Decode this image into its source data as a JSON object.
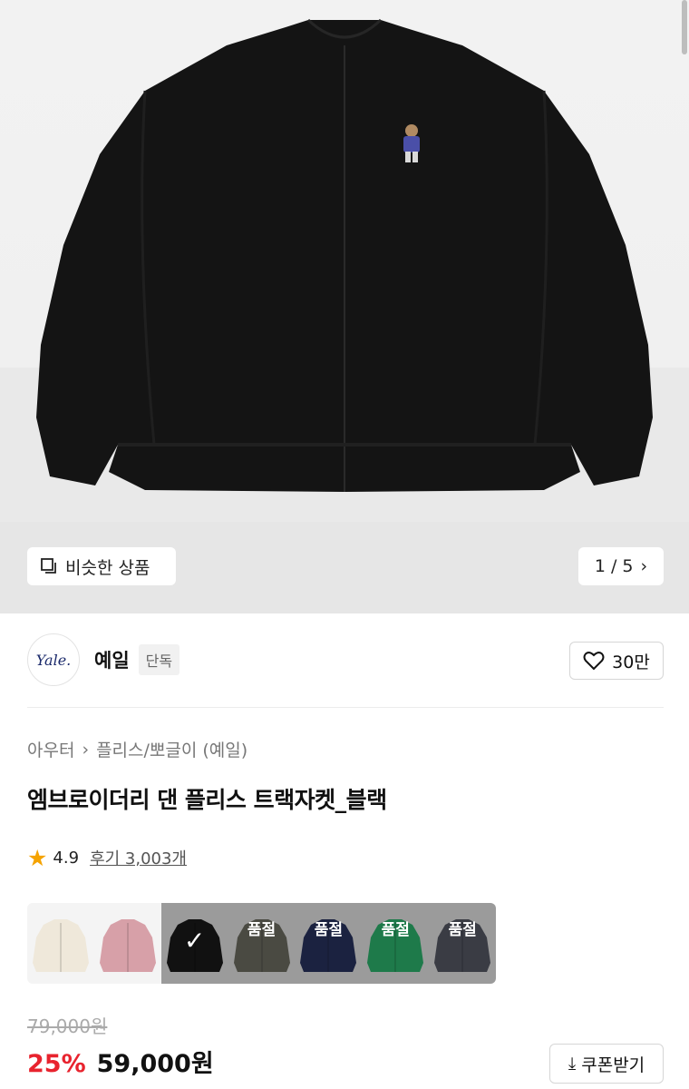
{
  "gallery": {
    "similar_label": "비슷한 상품",
    "pager": "1 / 5"
  },
  "brand": {
    "logo_text": "Yale.",
    "name": "예일",
    "badge": "단독",
    "likes": "30만"
  },
  "breadcrumb": {
    "category": "아우터",
    "subcategory": "플리스/뽀글이 (예일)"
  },
  "product": {
    "title": "엠브로이더리 댄 플리스 트랙자켓_블랙",
    "rating": "4.9",
    "reviews": "후기 3,003개"
  },
  "swatches": [
    {
      "color": "#efe8da",
      "state": "available",
      "label": ""
    },
    {
      "color": "#d7a0a8",
      "state": "available",
      "label": ""
    },
    {
      "color": "#111111",
      "state": "selected",
      "label": ""
    },
    {
      "color": "#4a4a42",
      "state": "soldout",
      "label": "품절"
    },
    {
      "color": "#1b2240",
      "state": "soldout",
      "label": "품절"
    },
    {
      "color": "#1e7a4a",
      "state": "soldout",
      "label": "품절"
    },
    {
      "color": "#3a3c44",
      "state": "soldout",
      "label": "품절"
    }
  ],
  "pricing": {
    "original": "79,000원",
    "discount": "25%",
    "price": "59,000원",
    "coupon_label": "쿠폰받기"
  },
  "colors": {
    "accent_red": "#e8232e",
    "star": "#f5a300"
  }
}
